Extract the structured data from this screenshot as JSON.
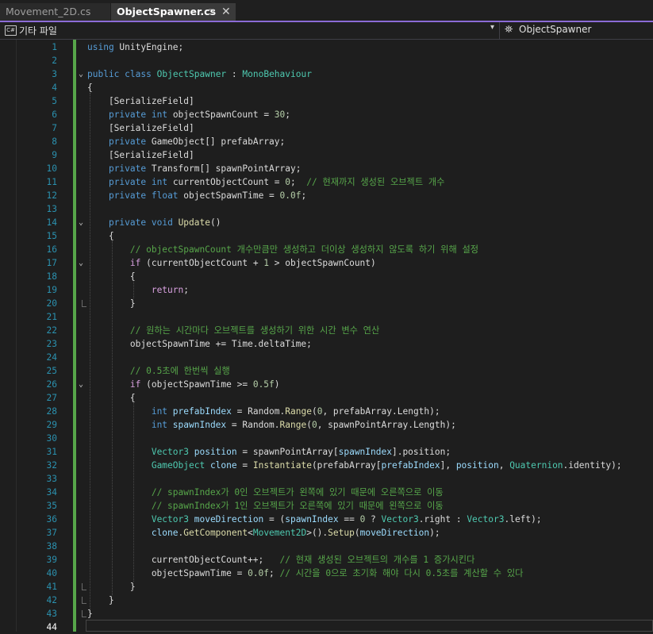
{
  "tabs": [
    {
      "label": "Movement_2D.cs",
      "active": false
    },
    {
      "label": "ObjectSpawner.cs",
      "active": true
    }
  ],
  "tab_pin_glyph": "⊐",
  "tab_close_glyph": "✕",
  "navbar": {
    "project_icon_text": "C#",
    "project_label": "기타 파일",
    "class_label": "ObjectSpawner"
  },
  "colors": {
    "keyword": "#569cd6",
    "type": "#4ec9b0",
    "comment": "#57a64a",
    "number": "#b5cea8",
    "method": "#dcdcaa",
    "local": "#9cdcfe",
    "control": "#d8a0df",
    "line_number": "#2b91af",
    "active_tab_accent": "#8b6bd6"
  },
  "editor": {
    "current_line": 44,
    "lines": [
      [
        [
          "kw",
          "using"
        ],
        [
          "t",
          " UnityEngine;"
        ]
      ],
      [],
      [
        [
          "kw",
          "public"
        ],
        [
          "t",
          " "
        ],
        [
          "kw",
          "class"
        ],
        [
          "t",
          " "
        ],
        [
          "ty",
          "ObjectSpawner"
        ],
        [
          "t",
          " : "
        ],
        [
          "ty",
          "MonoBehaviour"
        ]
      ],
      [
        [
          "t",
          "{"
        ]
      ],
      [
        [
          "t",
          "    [SerializeField]"
        ]
      ],
      [
        [
          "t",
          "    "
        ],
        [
          "kw",
          "private"
        ],
        [
          "t",
          " "
        ],
        [
          "kw",
          "int"
        ],
        [
          "t",
          " objectSpawnCount = "
        ],
        [
          "nm",
          "30"
        ],
        [
          "t",
          ";"
        ]
      ],
      [
        [
          "t",
          "    [SerializeField]"
        ]
      ],
      [
        [
          "t",
          "    "
        ],
        [
          "kw",
          "private"
        ],
        [
          "t",
          " GameObject[] prefabArray;"
        ]
      ],
      [
        [
          "t",
          "    [SerializeField]"
        ]
      ],
      [
        [
          "t",
          "    "
        ],
        [
          "kw",
          "private"
        ],
        [
          "t",
          " Transform[] spawnPointArray;"
        ]
      ],
      [
        [
          "t",
          "    "
        ],
        [
          "kw",
          "private"
        ],
        [
          "t",
          " "
        ],
        [
          "kw",
          "int"
        ],
        [
          "t",
          " currentObjectCount = "
        ],
        [
          "nm",
          "0"
        ],
        [
          "t",
          ";  "
        ],
        [
          "cm",
          "// 현재까지 생성된 오브젝트 개수"
        ]
      ],
      [
        [
          "t",
          "    "
        ],
        [
          "kw",
          "private"
        ],
        [
          "t",
          " "
        ],
        [
          "kw",
          "float"
        ],
        [
          "t",
          " objectSpawnTime = "
        ],
        [
          "nm",
          "0.0f"
        ],
        [
          "t",
          ";"
        ]
      ],
      [],
      [
        [
          "t",
          "    "
        ],
        [
          "kw",
          "private"
        ],
        [
          "t",
          " "
        ],
        [
          "kw",
          "void"
        ],
        [
          "t",
          " "
        ],
        [
          "mt",
          "Update"
        ],
        [
          "t",
          "()"
        ]
      ],
      [
        [
          "t",
          "    {"
        ]
      ],
      [
        [
          "t",
          "        "
        ],
        [
          "cm",
          "// objectSpawnCount 개수만큼만 생성하고 더이상 생성하지 않도록 하기 위해 설정"
        ]
      ],
      [
        [
          "t",
          "        "
        ],
        [
          "ctl",
          "if"
        ],
        [
          "t",
          " (currentObjectCount + "
        ],
        [
          "nm",
          "1"
        ],
        [
          "t",
          " > objectSpawnCount)"
        ]
      ],
      [
        [
          "t",
          "        {"
        ]
      ],
      [
        [
          "t",
          "            "
        ],
        [
          "ctl",
          "return"
        ],
        [
          "t",
          ";"
        ]
      ],
      [
        [
          "t",
          "        }"
        ]
      ],
      [],
      [
        [
          "t",
          "        "
        ],
        [
          "cm",
          "// 원하는 시간마다 오브젝트를 생성하기 위한 시간 변수 연산"
        ]
      ],
      [
        [
          "t",
          "        objectSpawnTime += Time.deltaTime;"
        ]
      ],
      [],
      [
        [
          "t",
          "        "
        ],
        [
          "cm",
          "// 0.5초에 한번씩 실행"
        ]
      ],
      [
        [
          "t",
          "        "
        ],
        [
          "ctl",
          "if"
        ],
        [
          "t",
          " (objectSpawnTime >= "
        ],
        [
          "nm",
          "0.5f"
        ],
        [
          "t",
          ")"
        ]
      ],
      [
        [
          "t",
          "        {"
        ]
      ],
      [
        [
          "t",
          "            "
        ],
        [
          "kw",
          "int"
        ],
        [
          "t",
          " "
        ],
        [
          "lv",
          "prefabIndex"
        ],
        [
          "t",
          " = Random."
        ],
        [
          "mt",
          "Range"
        ],
        [
          "t",
          "("
        ],
        [
          "nm",
          "0"
        ],
        [
          "t",
          ", prefabArray.Length);"
        ]
      ],
      [
        [
          "t",
          "            "
        ],
        [
          "kw",
          "int"
        ],
        [
          "t",
          " "
        ],
        [
          "lv",
          "spawnIndex"
        ],
        [
          "t",
          " = Random."
        ],
        [
          "mt",
          "Range"
        ],
        [
          "t",
          "("
        ],
        [
          "nm",
          "0"
        ],
        [
          "t",
          ", spawnPointArray.Length);"
        ]
      ],
      [],
      [
        [
          "t",
          "            "
        ],
        [
          "ty",
          "Vector3"
        ],
        [
          "t",
          " "
        ],
        [
          "lv",
          "position"
        ],
        [
          "t",
          " = spawnPointArray["
        ],
        [
          "lv",
          "spawnIndex"
        ],
        [
          "t",
          "].position;"
        ]
      ],
      [
        [
          "t",
          "            "
        ],
        [
          "ty",
          "GameObject"
        ],
        [
          "t",
          " "
        ],
        [
          "lv",
          "clone"
        ],
        [
          "t",
          " = "
        ],
        [
          "mt",
          "Instantiate"
        ],
        [
          "t",
          "(prefabArray["
        ],
        [
          "lv",
          "prefabIndex"
        ],
        [
          "t",
          "], "
        ],
        [
          "lv",
          "position"
        ],
        [
          "t",
          ", "
        ],
        [
          "ty",
          "Quaternion"
        ],
        [
          "t",
          ".identity);"
        ]
      ],
      [],
      [
        [
          "t",
          "            "
        ],
        [
          "cm",
          "// spawnIndex가 0인 오브젝트가 왼쪽에 있기 때문에 오른쪽으로 이동"
        ]
      ],
      [
        [
          "t",
          "            "
        ],
        [
          "cm",
          "// spawnIndex가 1인 오브젝트가 오른쪽에 있기 때문에 왼쪽으로 이동"
        ]
      ],
      [
        [
          "t",
          "            "
        ],
        [
          "ty",
          "Vector3"
        ],
        [
          "t",
          " "
        ],
        [
          "lv",
          "moveDirection"
        ],
        [
          "t",
          " = ("
        ],
        [
          "lv",
          "spawnIndex"
        ],
        [
          "t",
          " == "
        ],
        [
          "nm",
          "0"
        ],
        [
          "t",
          " ? "
        ],
        [
          "ty",
          "Vector3"
        ],
        [
          "t",
          ".right : "
        ],
        [
          "ty",
          "Vector3"
        ],
        [
          "t",
          ".left);"
        ]
      ],
      [
        [
          "t",
          "            "
        ],
        [
          "lv",
          "clone"
        ],
        [
          "t",
          "."
        ],
        [
          "mt",
          "GetComponent"
        ],
        [
          "t",
          "<"
        ],
        [
          "ty",
          "Movement2D"
        ],
        [
          "t",
          ">()."
        ],
        [
          "mt",
          "Setup"
        ],
        [
          "t",
          "("
        ],
        [
          "lv",
          "moveDirection"
        ],
        [
          "t",
          ");"
        ]
      ],
      [],
      [
        [
          "t",
          "            currentObjectCount++;   "
        ],
        [
          "cm",
          "// 현재 생성된 오브젝트의 개수를 1 증가시킨다"
        ]
      ],
      [
        [
          "t",
          "            objectSpawnTime = "
        ],
        [
          "nm",
          "0.0f"
        ],
        [
          "t",
          "; "
        ],
        [
          "cm",
          "// 시간을 0으로 초기화 해야 다시 0.5초를 계산할 수 있다"
        ]
      ],
      [
        [
          "t",
          "        }"
        ]
      ],
      [
        [
          "t",
          "    }"
        ]
      ],
      [
        [
          "t",
          "}"
        ]
      ],
      []
    ],
    "fold_lines": [
      3,
      14,
      17,
      26
    ]
  }
}
